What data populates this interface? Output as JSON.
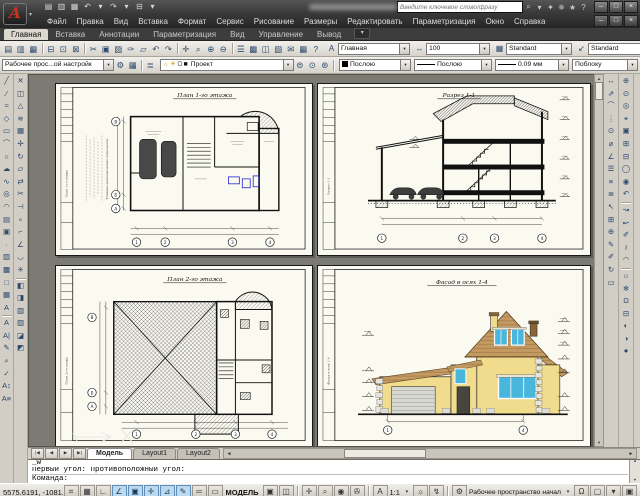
{
  "app": {
    "search_placeholder": "Введите ключевое слово/фразу",
    "win_controls": [
      "–",
      "□",
      "×"
    ],
    "doc_controls": [
      "–",
      "□",
      "×"
    ],
    "ribbon_min": "▾"
  },
  "ui": {
    "combo_arrow": "▾",
    "scroll_left": "◄",
    "scroll_right": "►",
    "scroll_up": "▲",
    "scroll_down": "▼",
    "annot_icon": "A",
    "gear": "⚙"
  },
  "qat": [
    {
      "g": "▤",
      "n": "qat-new-icon"
    },
    {
      "g": "▥",
      "n": "qat-open-icon"
    },
    {
      "g": "▦",
      "n": "qat-save-icon"
    },
    {
      "g": "↶",
      "n": "qat-undo-icon"
    },
    {
      "g": "▾",
      "n": "qat-undo-arrow-icon"
    },
    {
      "g": "↷",
      "n": "qat-redo-icon"
    },
    {
      "g": "▾",
      "n": "qat-redo-arrow-icon"
    },
    {
      "g": "⊟",
      "n": "qat-plot-icon"
    },
    {
      "g": "▾",
      "n": "qat-customize-icon"
    }
  ],
  "search_buttons": [
    {
      "g": "⌕",
      "n": "search-icon"
    },
    {
      "g": "▾",
      "n": "search-arrow-icon"
    },
    {
      "g": "✦",
      "n": "key-icon"
    },
    {
      "g": "✵",
      "n": "satellite-icon"
    },
    {
      "g": "★",
      "n": "favorites-icon"
    },
    {
      "g": "?",
      "n": "help-icon"
    }
  ],
  "menus": [
    {
      "g": "Файл",
      "n": "menu-file"
    },
    {
      "g": "Правка",
      "n": "menu-edit"
    },
    {
      "g": "Вид",
      "n": "menu-view"
    },
    {
      "g": "Вставка",
      "n": "menu-insert"
    },
    {
      "g": "Формат",
      "n": "menu-format"
    },
    {
      "g": "Сервис",
      "n": "menu-tools"
    },
    {
      "g": "Рисование",
      "n": "menu-draw"
    },
    {
      "g": "Размеры",
      "n": "menu-dimension"
    },
    {
      "g": "Редактировать",
      "n": "menu-modify"
    },
    {
      "g": "Параметризация",
      "n": "menu-parametric"
    },
    {
      "g": "Окно",
      "n": "menu-window"
    },
    {
      "g": "Справка",
      "n": "menu-help"
    }
  ],
  "ribbon_tabs": [
    {
      "g": "Главная",
      "n": "tab-home",
      "on": true
    },
    {
      "g": "Вставка",
      "n": "tab-insert"
    },
    {
      "g": "Аннотации",
      "n": "tab-annotate"
    },
    {
      "g": "Параметризация",
      "n": "tab-parametric"
    },
    {
      "g": "Вид",
      "n": "tab-view"
    },
    {
      "g": "Управление",
      "n": "tab-manage"
    },
    {
      "g": "Вывод",
      "n": "tab-output"
    }
  ],
  "standard_toolbar": [
    {
      "g": "▤",
      "n": "new-icon"
    },
    {
      "g": "▥",
      "n": "open-icon"
    },
    {
      "g": "▦",
      "n": "save-icon"
    },
    {
      "sep": 1
    },
    {
      "g": "⊟",
      "n": "plot-icon"
    },
    {
      "g": "⊡",
      "n": "plot-preview-icon"
    },
    {
      "g": "⊠",
      "n": "publish-icon"
    },
    {
      "sep": 1
    },
    {
      "g": "✂",
      "n": "cut-icon"
    },
    {
      "g": "▣",
      "n": "copy-icon"
    },
    {
      "g": "▨",
      "n": "paste-icon"
    },
    {
      "g": "✑",
      "n": "match-properties-icon"
    },
    {
      "g": "▱",
      "n": "block-editor-icon"
    },
    {
      "g": "↶",
      "n": "undo-icon"
    },
    {
      "g": "↷",
      "n": "redo-icon"
    },
    {
      "sep": 1
    },
    {
      "g": "✛",
      "n": "pan-icon"
    },
    {
      "g": "⌕",
      "n": "zoom-realtime-icon"
    },
    {
      "g": "⊕",
      "n": "zoom-window-icon"
    },
    {
      "g": "⊖",
      "n": "zoom-previous-icon"
    },
    {
      "sep": 1
    },
    {
      "g": "☰",
      "n": "properties-icon"
    },
    {
      "g": "▩",
      "n": "designcenter-icon"
    },
    {
      "g": "◫",
      "n": "tool-palettes-icon"
    },
    {
      "g": "▧",
      "n": "sheetset-manager-icon"
    },
    {
      "g": "✉",
      "n": "markup-icon"
    },
    {
      "g": "▦",
      "n": "quickcalc-icon"
    },
    {
      "g": "?",
      "n": "help-icon"
    }
  ],
  "styles_toolbar": {
    "text_icon": "A",
    "dim_icon": "↔",
    "table_icon": "▦",
    "mleader_icon": "↙",
    "text_style": "Главная",
    "dim_style": "100",
    "table_style": "Standard",
    "mleader_style": "Standard"
  },
  "properties_toolbar": {
    "workspace": "Рабочее прос...ой настройк",
    "workspace_buttons": [
      {
        "g": "⚙",
        "n": "workspace-settings-icon"
      },
      {
        "g": "▦",
        "n": "workspace-save-icon"
      }
    ],
    "layer_manager_icon": {
      "g": "≣",
      "n": "layer-properties-icon"
    },
    "layer_state_icons": [
      {
        "g": "☼",
        "n": "layer-on-icon"
      },
      {
        "g": "☀",
        "n": "layer-freeze-icon"
      },
      {
        "g": "Ω",
        "n": "layer-lock-icon"
      },
      {
        "g": "■",
        "n": "layer-color-swatch"
      }
    ],
    "layer": "Проект",
    "layer_buttons": [
      {
        "g": "⊜",
        "n": "layer-previous-icon"
      },
      {
        "g": "⊙",
        "n": "layer-state-icon"
      },
      {
        "g": "⊛",
        "n": "layer-isolate-icon"
      }
    ],
    "color": "Послою",
    "linetype": "Послою",
    "lineweight": "0.09 мм",
    "plot_style": "Поблоку"
  },
  "left_col1": [
    {
      "g": "╱",
      "n": "line-icon"
    },
    {
      "g": "∕",
      "n": "construction-line-icon"
    },
    {
      "g": "≈",
      "n": "polyline-icon"
    },
    {
      "g": "◇",
      "n": "polygon-icon"
    },
    {
      "g": "▭",
      "n": "rectangle-icon"
    },
    {
      "g": "⌒",
      "n": "arc-icon"
    },
    {
      "g": "○",
      "n": "circle-icon"
    },
    {
      "g": "☁",
      "n": "revision-cloud-icon"
    },
    {
      "g": "∿",
      "n": "spline-icon"
    },
    {
      "g": "◎",
      "n": "ellipse-icon"
    },
    {
      "g": "◠",
      "n": "ellipse-arc-icon"
    },
    {
      "g": "▤",
      "n": "insert-block-icon"
    },
    {
      "g": "▣",
      "n": "make-block-icon"
    },
    {
      "g": "·",
      "n": "point-icon"
    },
    {
      "g": "▨",
      "n": "hatch-icon"
    },
    {
      "g": "▩",
      "n": "gradient-icon"
    },
    {
      "g": "□",
      "n": "region-icon"
    },
    {
      "g": "▦",
      "n": "table-icon"
    },
    {
      "g": "A",
      "n": "mtext-icon"
    },
    {
      "sep": 1
    },
    {
      "g": "A",
      "n": "text-icon"
    },
    {
      "g": "A|",
      "n": "single-text-icon"
    },
    {
      "g": "✎",
      "n": "edit-text-icon"
    },
    {
      "g": "⌕",
      "n": "find-text-icon"
    },
    {
      "g": "✓",
      "n": "spellcheck-icon"
    },
    {
      "g": "A↕",
      "n": "text-scale-icon"
    },
    {
      "g": "A≡",
      "n": "text-justify-icon"
    }
  ],
  "left_col2": [
    {
      "g": "✕",
      "n": "erase-icon"
    },
    {
      "g": "◫",
      "n": "copy-object-icon"
    },
    {
      "g": "△",
      "n": "mirror-icon"
    },
    {
      "g": "≋",
      "n": "offset-icon"
    },
    {
      "g": "▦",
      "n": "array-icon"
    },
    {
      "g": "✢",
      "n": "move-icon"
    },
    {
      "g": "↻",
      "n": "rotate-icon"
    },
    {
      "g": "▱",
      "n": "scale-icon"
    },
    {
      "g": "⇄",
      "n": "stretch-icon"
    },
    {
      "g": "✂",
      "n": "trim-icon"
    },
    {
      "g": "⊣",
      "n": "extend-icon"
    },
    {
      "g": "∘",
      "n": "break-icon"
    },
    {
      "g": "⌐",
      "n": "join-icon"
    },
    {
      "g": "∠",
      "n": "chamfer-icon"
    },
    {
      "g": "◡",
      "n": "fillet-icon"
    },
    {
      "g": "✳",
      "n": "explode-icon"
    },
    {
      "sep": 1
    },
    {
      "g": "◧",
      "n": "draworder-front-icon"
    },
    {
      "g": "◨",
      "n": "draworder-back-icon"
    },
    {
      "g": "▧",
      "n": "draworder-above-icon"
    },
    {
      "g": "▨",
      "n": "draworder-under-icon"
    },
    {
      "g": "◪",
      "n": "isolate-objects-icon"
    },
    {
      "g": "◩",
      "n": "hide-objects-icon"
    }
  ],
  "right_col1": [
    {
      "g": "↔",
      "n": "dim-linear-icon"
    },
    {
      "g": "⇗",
      "n": "dim-aligned-icon"
    },
    {
      "g": "⌒",
      "n": "dim-arc-icon"
    },
    {
      "g": "⋮",
      "n": "dim-ordinate-icon"
    },
    {
      "g": "⊙",
      "n": "dim-radius-icon"
    },
    {
      "g": "⌀",
      "n": "dim-diameter-icon"
    },
    {
      "g": "∠",
      "n": "dim-angular-icon"
    },
    {
      "g": "☰",
      "n": "dim-quick-icon"
    },
    {
      "g": "≡",
      "n": "dim-baseline-icon"
    },
    {
      "g": "≣",
      "n": "dim-continue-icon"
    },
    {
      "g": "↖",
      "n": "leader-icon"
    },
    {
      "g": "⊞",
      "n": "tolerance-icon"
    },
    {
      "g": "⊕",
      "n": "center-mark-icon"
    },
    {
      "g": "✎",
      "n": "dim-edit-icon"
    },
    {
      "g": "✐",
      "n": "dim-text-edit-icon"
    },
    {
      "g": "↻",
      "n": "dim-update-icon"
    },
    {
      "g": "▭",
      "n": "dim-style-icon"
    }
  ],
  "right_col2": [
    {
      "g": "⊕",
      "n": "zoom-window-icon"
    },
    {
      "g": "⊙",
      "n": "zoom-dynamic-icon"
    },
    {
      "g": "◎",
      "n": "zoom-scale-icon"
    },
    {
      "g": "⌖",
      "n": "zoom-center-icon"
    },
    {
      "g": "▣",
      "n": "zoom-object-icon"
    },
    {
      "g": "⊞",
      "n": "zoom-in-icon"
    },
    {
      "g": "⊟",
      "n": "zoom-out-icon"
    },
    {
      "g": "◯",
      "n": "zoom-all-icon"
    },
    {
      "g": "◉",
      "n": "zoom-extents-icon"
    },
    {
      "g": "↶",
      "n": "zoom-previous-icon"
    },
    {
      "sep": 1
    },
    {
      "g": "↝",
      "n": "pedit-icon"
    },
    {
      "g": "↜",
      "n": "spline-edit-icon"
    },
    {
      "g": "✐",
      "n": "hatch-edit-icon"
    },
    {
      "g": "≀",
      "n": "curve-icon"
    },
    {
      "g": "◠",
      "n": "arc-edit-icon"
    },
    {
      "sep": 1
    },
    {
      "g": "☼",
      "n": "layer-walk-icon"
    },
    {
      "g": "❄",
      "n": "layer-freeze-tool-icon"
    },
    {
      "g": "Ω",
      "n": "layer-lock-tool-icon"
    },
    {
      "g": "⊟",
      "n": "layer-off-icon"
    },
    {
      "g": "◐",
      "n": "layer-match-icon"
    },
    {
      "g": "◑",
      "n": "layer-copy-icon"
    },
    {
      "g": "●",
      "n": "layer-current-icon"
    }
  ],
  "sheets": {
    "tl": {
      "title": "План 1-го этажа",
      "tei": "Технико-экономические показатели",
      "axes_h": [
        "1",
        "2",
        "3",
        "4"
      ],
      "axes_v": [
        "В",
        "Б",
        "А"
      ]
    },
    "tr": {
      "title": "Разрез 1-1",
      "axes_h": [
        "1",
        "2",
        "3",
        "4"
      ]
    },
    "bl": {
      "title": "План 2-го этажа",
      "axes_h": [
        "1",
        "2",
        "3",
        "4"
      ],
      "axes_v": [
        "В",
        "Б",
        "А"
      ]
    },
    "br": {
      "title": "Фасад в осях 1-4",
      "axes_h": [
        "1",
        "4"
      ]
    }
  },
  "layout_tabs": {
    "nav": [
      {
        "g": "|◀",
        "n": "tab-first-icon"
      },
      {
        "g": "◀",
        "n": "tab-prev-icon"
      },
      {
        "g": "▶",
        "n": "tab-next-icon"
      },
      {
        "g": "▶|",
        "n": "tab-last-icon"
      }
    ],
    "tabs": [
      {
        "label": "Модель"
      },
      {
        "label": "Layout1"
      },
      {
        "label": "Layout2"
      }
    ]
  },
  "command": {
    "history1": "_w",
    "history2": "Первый угол: Противоположный угол:",
    "prompt": "Команда:"
  },
  "statusbar": {
    "coords": "5575.6191, -1081.6714, 0.0000",
    "toggles": [
      {
        "g": "⌗",
        "n": "snap-toggle"
      },
      {
        "g": "▦",
        "n": "grid-toggle"
      },
      {
        "g": "∟",
        "n": "ortho-toggle"
      },
      {
        "g": "∠",
        "n": "polar-toggle",
        "on": true
      },
      {
        "g": "▣",
        "n": "osnap-toggle",
        "on": true
      },
      {
        "g": "✛",
        "n": "otrack-toggle",
        "on": true
      },
      {
        "g": "⊿",
        "n": "ducs-toggle",
        "on": true
      },
      {
        "g": "✎",
        "n": "dyn-toggle",
        "on": true
      },
      {
        "g": "═",
        "n": "lwt-toggle"
      },
      {
        "g": "▭",
        "n": "qp-toggle"
      }
    ],
    "model": "МОДЕЛЬ",
    "icons1": [
      {
        "g": "▣",
        "n": "quick-view-layouts-icon"
      },
      {
        "g": "◫",
        "n": "quick-view-drawings-icon"
      }
    ],
    "icons2": [
      {
        "g": "✛",
        "n": "pan-icon"
      },
      {
        "g": "⌕",
        "n": "zoom-icon"
      },
      {
        "g": "◉",
        "n": "steering-wheel-icon"
      },
      {
        "g": "✇",
        "n": "showmotion-icon"
      }
    ],
    "scale": "1:1",
    "icons3": [
      {
        "g": "☼",
        "n": "annotation-visibility-icon"
      },
      {
        "g": "↯",
        "n": "annotation-autoscale-icon"
      }
    ],
    "workspace": "Рабочее пространство начал",
    "icons4": [
      {
        "g": "Ω",
        "n": "lock-ui-icon"
      },
      {
        "g": "▢",
        "n": "status-tray-icon"
      },
      {
        "g": "▾",
        "n": "status-tray-arrow-icon"
      },
      {
        "g": "▣",
        "n": "clean-screen-icon"
      }
    ]
  }
}
